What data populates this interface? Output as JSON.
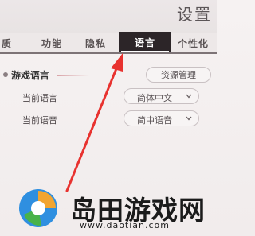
{
  "header": {
    "title": "设置"
  },
  "tabs": [
    {
      "label": "质"
    },
    {
      "label": "功能"
    },
    {
      "label": "隐私"
    },
    {
      "label": "语言",
      "active": true
    },
    {
      "label": "个性化"
    }
  ],
  "section": {
    "label": "游戏语言"
  },
  "buttons": {
    "manage_resources": "资源管理"
  },
  "rows": [
    {
      "label": "当前语言",
      "value": "简体中文"
    },
    {
      "label": "当前语音",
      "value": "简中语音"
    }
  ],
  "watermark": {
    "brand": "岛田游戏网",
    "url": "www.daotian.com"
  },
  "colors": {
    "arrow": "#e8322f",
    "active_tab_bg": "#2c2528",
    "logo_orange": "#f2a531",
    "logo_blue": "#2f8fe0",
    "logo_green": "#49b24a"
  }
}
